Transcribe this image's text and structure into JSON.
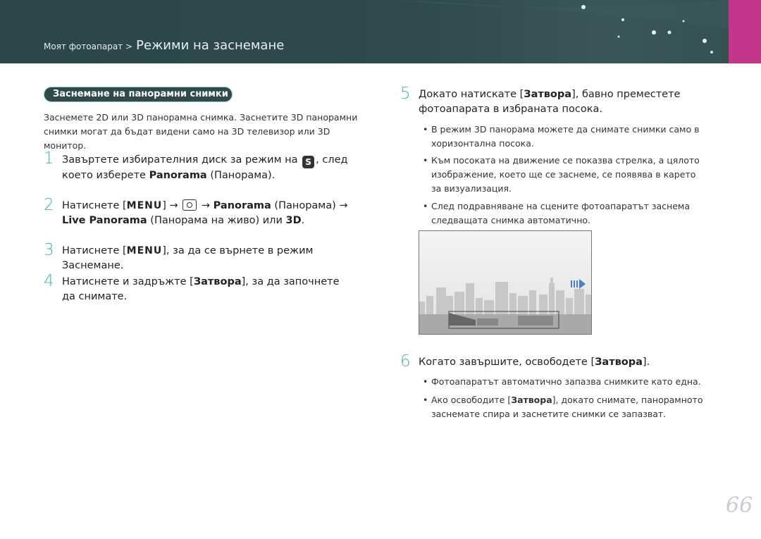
{
  "header": {
    "breadcrumb_small": "Моят фотоапарат >",
    "breadcrumb_big": "Режими на заснемане"
  },
  "section": {
    "title": "Заснемане на панорамни снимки",
    "intro": "Заснемете 2D или 3D панорамна снимка. Заснетите 3D панорамни снимки могат да бъдат видени само на 3D телевизор или 3D монитор."
  },
  "steps": {
    "s1": {
      "num": "1",
      "a": "Завъртете избирателния диск за режим на",
      "icon": "S",
      "b": ", след което изберете ",
      "bold": "Panorama",
      "c": " (Панорама)."
    },
    "s2": {
      "num": "2",
      "a": "Натиснете [",
      "menu": "MENU",
      "b": "] → ",
      "c": " → ",
      "bold1": "Panorama",
      "d": " (Панорама) →",
      "bold2": "Live Panorama",
      "e": " (Панорама на живо) или ",
      "bold3": "3D",
      "f": "."
    },
    "s3": {
      "num": "3",
      "a": "Натиснете [",
      "menu": "MENU",
      "b": "], за да се върнете в режим Заснемане."
    },
    "s4": {
      "num": "4",
      "a": "Натиснете и задръжте [",
      "bold": "Затвора",
      "b": "], за да започнете да снимате."
    },
    "s5": {
      "num": "5",
      "a": "Докато натискате [",
      "bold": "Затвора",
      "b": "], бавно преместете фотоапарата в избраната посока."
    },
    "s6": {
      "num": "6",
      "a": "Когато завършите, освободете [",
      "bold": "Затвора",
      "b": "]."
    }
  },
  "bullets5": [
    "В режим 3D панорама можете да снимате снимки само в хоризонтална посока.",
    "Към посоката на движение се показва стрелка, а цялото изображение, което ще се заснеме, се появява в карето за визуализация.",
    "След подравняване на сцените фотоапаратът заснема следващата снимка автоматично."
  ],
  "bullets6": {
    "b1": "Фотоапаратът автоматично запазва снимките като една.",
    "b2a": "Ако освободите [",
    "b2bold": "Затвора",
    "b2b": "], докато снимате, панорамното заснемате спира и заснетите снимки се запазват."
  },
  "bullet_char": "•",
  "page_number": "66",
  "colors": {
    "accent": "#47b89c",
    "header": "#2f4a4d",
    "tab": "#c2368c"
  }
}
